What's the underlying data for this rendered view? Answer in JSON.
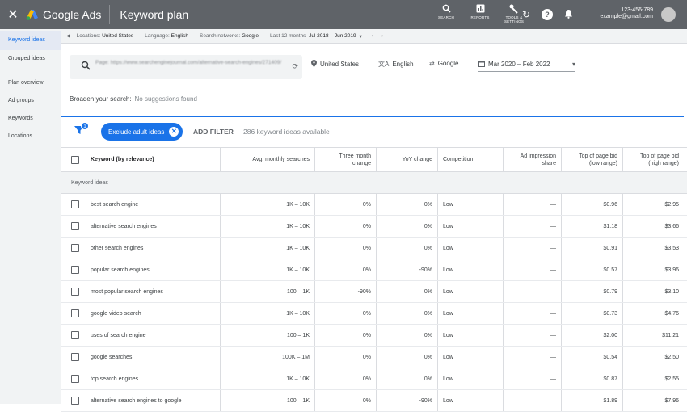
{
  "app": {
    "brand": "Google Ads",
    "page_title": "Keyword plan",
    "close_glyph": "✕",
    "tools": [
      {
        "icon": "search-icon",
        "glyph": "🔍",
        "label": "SEARCH"
      },
      {
        "icon": "reports-icon",
        "glyph": "▥",
        "label": "REPORTS"
      },
      {
        "icon": "wrench-icon",
        "glyph": "🔧",
        "label_line1": "TOOLS &",
        "label_line2": "SETTINGS"
      }
    ],
    "account_id": "123-456-789",
    "account_email": "example@gmail.com"
  },
  "sidebar": {
    "items": [
      {
        "label": "Keyword ideas",
        "active": true
      },
      {
        "label": "Grouped ideas",
        "active": false
      },
      {
        "label": "Plan overview",
        "active": false
      },
      {
        "label": "Ad groups",
        "active": false
      },
      {
        "label": "Keywords",
        "active": false
      },
      {
        "label": "Locations",
        "active": false
      }
    ]
  },
  "filter_strip": {
    "locations_label": "Locations:",
    "locations_value": "United States",
    "language_label": "Language:",
    "language_value": "English",
    "networks_label": "Search networks:",
    "networks_value": "Google",
    "period_label": "Last 12 months",
    "period_value": "Jul 2018 – Jun 2019"
  },
  "search": {
    "query_blurred": "Page: https://www.searchenginejournal.com/alternative-search-engines/271409/",
    "location": "United States",
    "language": "English",
    "network": "Google",
    "date_range": "Mar 2020 – Feb 2022"
  },
  "broaden": {
    "label": "Broaden your search:",
    "value": "No suggestions found"
  },
  "filters": {
    "badge_count": "1",
    "chip_label": "Exclude adult ideas",
    "add_filter": "ADD FILTER",
    "count_text": "286 keyword ideas available"
  },
  "table": {
    "headers": {
      "keyword": "Keyword (by relevance)",
      "avg": "Avg. monthly searches",
      "three_month_1": "Three month",
      "three_month_2": "change",
      "yoy": "YoY change",
      "competition": "Competition",
      "impr_1": "Ad impression",
      "impr_2": "share",
      "bid_low_1": "Top of page bid",
      "bid_low_2": "(low range)",
      "bid_high_1": "Top of page bid",
      "bid_high_2": "(high range)"
    },
    "group_label": "Keyword ideas",
    "rows": [
      {
        "keyword": "best search engine",
        "avg": "1K – 10K",
        "three": "0%",
        "yoy": "0%",
        "comp": "Low",
        "impr": "—",
        "low": "$0.96",
        "high": "$2.95"
      },
      {
        "keyword": "alternative search engines",
        "avg": "1K – 10K",
        "three": "0%",
        "yoy": "0%",
        "comp": "Low",
        "impr": "—",
        "low": "$1.18",
        "high": "$3.66"
      },
      {
        "keyword": "other search engines",
        "avg": "1K – 10K",
        "three": "0%",
        "yoy": "0%",
        "comp": "Low",
        "impr": "—",
        "low": "$0.91",
        "high": "$3.53"
      },
      {
        "keyword": "popular search engines",
        "avg": "1K – 10K",
        "three": "0%",
        "yoy": "-90%",
        "comp": "Low",
        "impr": "—",
        "low": "$0.57",
        "high": "$3.96"
      },
      {
        "keyword": "most popular search engines",
        "avg": "100 – 1K",
        "three": "-90%",
        "yoy": "0%",
        "comp": "Low",
        "impr": "—",
        "low": "$0.79",
        "high": "$3.10"
      },
      {
        "keyword": "google video search",
        "avg": "1K – 10K",
        "three": "0%",
        "yoy": "0%",
        "comp": "Low",
        "impr": "—",
        "low": "$0.73",
        "high": "$4.76"
      },
      {
        "keyword": "uses of search engine",
        "avg": "100 – 1K",
        "three": "0%",
        "yoy": "0%",
        "comp": "Low",
        "impr": "—",
        "low": "$2.00",
        "high": "$11.21"
      },
      {
        "keyword": "google searches",
        "avg": "100K – 1M",
        "three": "0%",
        "yoy": "0%",
        "comp": "Low",
        "impr": "—",
        "low": "$0.54",
        "high": "$2.50"
      },
      {
        "keyword": "top search engines",
        "avg": "1K – 10K",
        "three": "0%",
        "yoy": "0%",
        "comp": "Low",
        "impr": "—",
        "low": "$0.87",
        "high": "$2.55"
      },
      {
        "keyword": "alternative search engines to google",
        "avg": "100 – 1K",
        "three": "0%",
        "yoy": "-90%",
        "comp": "Low",
        "impr": "—",
        "low": "$1.89",
        "high": "$7.96"
      }
    ]
  },
  "colors": {
    "topbar": "#5f6368",
    "accent": "#1a73e8",
    "sidebar_bg": "#f1f3f4"
  }
}
